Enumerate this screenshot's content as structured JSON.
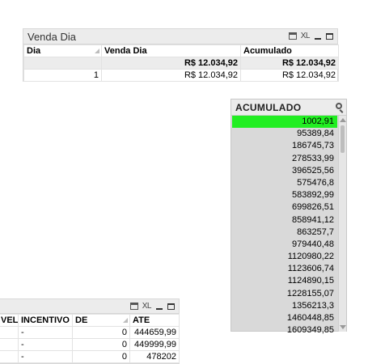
{
  "venda_dia": {
    "title": "Venda Dia",
    "icons": {
      "print": "print-icon",
      "xl": "XL",
      "minimize": "minimize-icon",
      "maximize": "maximize-icon"
    },
    "headers": [
      "Dia",
      "Venda Dia",
      "Acumulado"
    ],
    "totals": [
      "",
      "R$ 12.034,92",
      "R$ 12.034,92"
    ],
    "rows": [
      [
        "1",
        "R$ 12.034,92",
        "R$ 12.034,92"
      ]
    ]
  },
  "acumulado_list": {
    "title": "ACUMULADO",
    "selected_color": "#22ee22",
    "items": [
      "1002,91",
      "95389,84",
      "186745,73",
      "278533,99",
      "396525,56",
      "575476,8",
      "583892,99",
      "699826,51",
      "858941,12",
      "863257,7",
      "979440,48",
      "1120980,22",
      "1123606,74",
      "1124890,15",
      "1228155,07",
      "1356213,3",
      "1460448,85",
      "1609349,85"
    ],
    "selected_index": 0
  },
  "bottom_table": {
    "icons": {
      "print": "print-icon",
      "xl": "XL",
      "minimize": "minimize-icon",
      "maximize": "maximize-icon"
    },
    "headers": [
      "VEL",
      "INCENTIVO",
      "DE",
      "ATE"
    ],
    "rows": [
      [
        "",
        "-",
        "0",
        "444659,99"
      ],
      [
        "",
        "-",
        "0",
        "449999,99"
      ],
      [
        "",
        "-",
        "0",
        "478202"
      ]
    ]
  }
}
